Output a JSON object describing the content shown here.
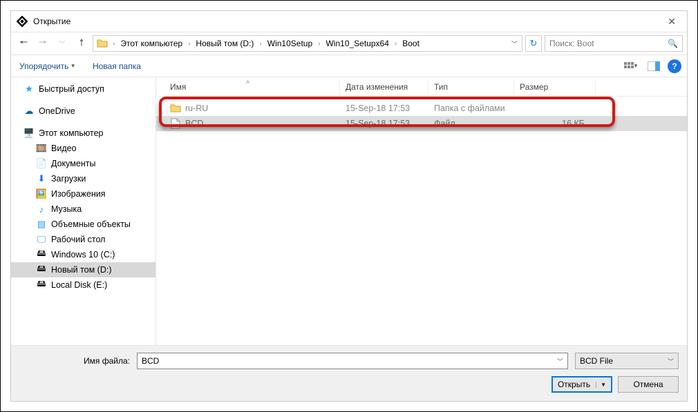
{
  "title": "Открытие",
  "breadcrumbs": [
    "Этот компьютер",
    "Новый том (D:)",
    "Win10Setup",
    "Win10_Setupx64",
    "Boot"
  ],
  "search_placeholder": "Поиск: Boot",
  "toolbar": {
    "organize": "Упорядочить",
    "new_folder": "Новая папка"
  },
  "sidebar": {
    "quick_access": "Быстрый доступ",
    "onedrive": "OneDrive",
    "this_pc": "Этот компьютер",
    "videos": "Видео",
    "documents": "Документы",
    "downloads": "Загрузки",
    "pictures": "Изображения",
    "music": "Музыка",
    "objects3d": "Объемные объекты",
    "desktop": "Рабочий стол",
    "drive_c": "Windows 10 (C:)",
    "drive_d": "Новый том (D:)",
    "drive_e": "Local Disk (E:)"
  },
  "columns": {
    "name": "Имя",
    "date": "Дата изменения",
    "type": "Тип",
    "size": "Размер"
  },
  "rows": [
    {
      "name": "ru-RU",
      "date": "15-Sep-18 17:53",
      "type": "Папка с файлами",
      "size": ""
    },
    {
      "name": "BCD",
      "date": "15-Sep-18 17:53",
      "type": "Файл",
      "size": "16 КБ"
    }
  ],
  "footer": {
    "filename_label": "Имя файла:",
    "filename_value": "BCD",
    "filetype": "BCD File",
    "open": "Открыть",
    "cancel": "Отмена"
  }
}
